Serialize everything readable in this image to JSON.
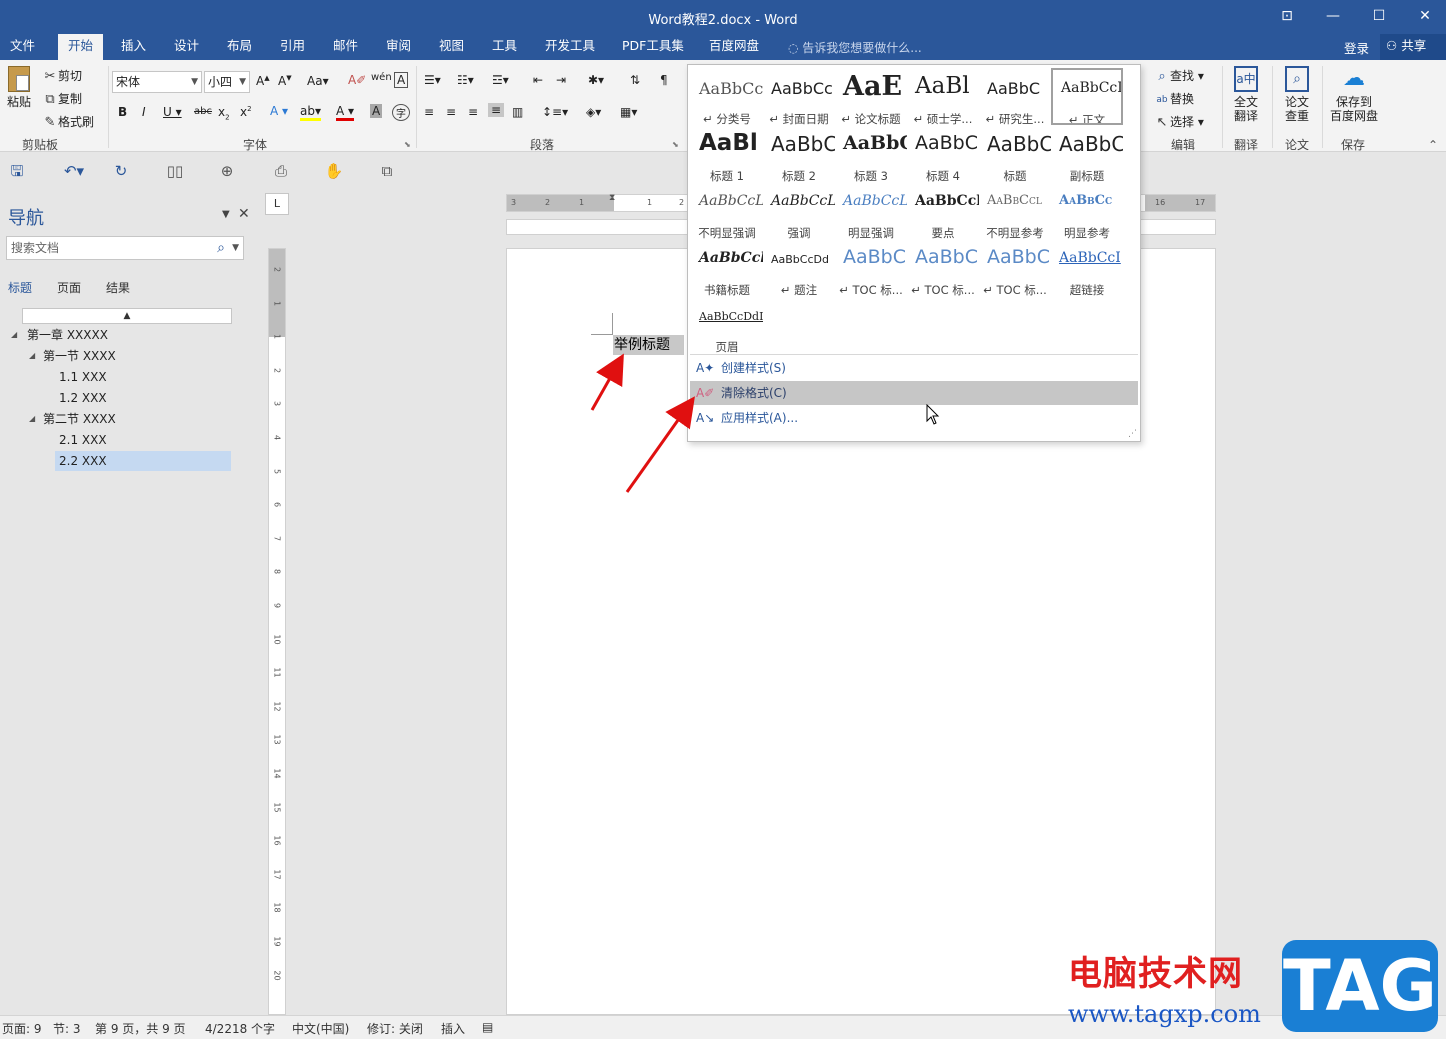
{
  "window": {
    "title": "Word教程2.docx - Word",
    "controls": {
      "ribbon_display": "⊡",
      "minimize": "—",
      "maximize": "☐",
      "close": "✕"
    }
  },
  "menu": {
    "tabs": [
      "文件",
      "开始",
      "插入",
      "设计",
      "布局",
      "引用",
      "邮件",
      "审阅",
      "视图",
      "工具",
      "开发工具",
      "PDF工具集",
      "百度网盘"
    ],
    "active_tab": "开始",
    "tell_me": "告诉我您想要做什么...",
    "login": "登录",
    "share": "共享"
  },
  "ribbon": {
    "clipboard": {
      "paste": "粘贴",
      "cut": "剪切",
      "copy": "复制",
      "format_painter": "格式刷",
      "label": "剪贴板"
    },
    "font": {
      "font_name": "宋体",
      "font_size": "小四",
      "label": "字体"
    },
    "paragraph": {
      "label": "段落"
    },
    "editing": {
      "find": "查找",
      "replace": "替换",
      "select": "选择",
      "label": "编辑"
    },
    "translate": {
      "button": "全文\n翻译",
      "line1": "全文",
      "line2": "翻译",
      "label": "翻译"
    },
    "paper": {
      "line1": "论文",
      "line2": "查重",
      "label": "论文"
    },
    "save": {
      "line1": "保存到",
      "line2": "百度网盘",
      "label": "保存"
    }
  },
  "navigation": {
    "title": "导航",
    "search_placeholder": "搜索文档",
    "tabs": [
      "标题",
      "页面",
      "结果"
    ],
    "active_tab": "标题",
    "tree": [
      {
        "label": "第一章 XXXXX",
        "level": 0
      },
      {
        "label": "第一节 XXXX",
        "level": 1
      },
      {
        "label": "1.1 XXX",
        "level": 2
      },
      {
        "label": "1.2 XXX",
        "level": 2
      },
      {
        "label": "第二节 XXXX",
        "level": 1
      },
      {
        "label": "2.1 XXX",
        "level": 2
      },
      {
        "label": "2.2 XXX",
        "level": 2,
        "selected": true
      }
    ]
  },
  "document": {
    "selected_text": "举例标题"
  },
  "styles_gallery": {
    "styles": [
      {
        "preview": "AaBbCc",
        "name": "↵ 分类号"
      },
      {
        "preview": "AaBbCc",
        "name": "↵ 封面日期"
      },
      {
        "preview": "AaE",
        "name": "↵ 论文标题"
      },
      {
        "preview": "AaBl",
        "name": "↵ 硕士学..."
      },
      {
        "preview": "AaBbC",
        "name": "↵ 研究生..."
      },
      {
        "preview": "AaBbCcI",
        "name": "↵ 正文",
        "selected": true
      },
      {
        "preview": "AaBl",
        "name": "标题 1"
      },
      {
        "preview": "AaBbC",
        "name": "标题 2"
      },
      {
        "preview": "AaBbC",
        "name": "标题 3"
      },
      {
        "preview": "AaBbC",
        "name": "标题 4"
      },
      {
        "preview": "AaBbC",
        "name": "标题"
      },
      {
        "preview": "AaBbC",
        "name": "副标题"
      },
      {
        "preview": "AaBbCcL",
        "name": "不明显强调"
      },
      {
        "preview": "AaBbCcL",
        "name": "强调"
      },
      {
        "preview": "AaBbCcL",
        "name": "明显强调"
      },
      {
        "preview": "AaBbCcl",
        "name": "要点"
      },
      {
        "preview": "AaBbCcl",
        "name": "不明显参考"
      },
      {
        "preview": "AaBbCc",
        "name": "明显参考"
      },
      {
        "preview": "AaBbCcl",
        "name": "书籍标题"
      },
      {
        "preview": "AaBbCcDd",
        "name": "↵ 题注"
      },
      {
        "preview": "AaBbC",
        "name": "↵ TOC 标..."
      },
      {
        "preview": "AaBbC",
        "name": "↵ TOC 标..."
      },
      {
        "preview": "AaBbC",
        "name": "↵ TOC 标..."
      },
      {
        "preview": "AaBbCcI",
        "name": "超链接"
      },
      {
        "preview": "AaBbCcDdI",
        "name": "页眉"
      }
    ],
    "menu": [
      {
        "label": "创建样式(S)"
      },
      {
        "label": "清除格式(C)",
        "highlighted": true
      },
      {
        "label": "应用样式(A)..."
      }
    ]
  },
  "ruler": {
    "h_ticks": [
      "3",
      "2",
      "1",
      "1",
      "2",
      "16",
      "17"
    ],
    "v_ticks": [
      "2",
      "1",
      "1",
      "2",
      "3",
      "4",
      "5",
      "6",
      "7",
      "8",
      "9",
      "10",
      "11",
      "12",
      "13",
      "14",
      "15",
      "16",
      "17",
      "18",
      "19",
      "20"
    ],
    "tab_selector": "L"
  },
  "status_bar": {
    "page": "页面: 9",
    "section": "节: 3",
    "page_of": "第 9 页，共 9 页",
    "words": "4/2218 个字",
    "language": "中文(中国)",
    "track_changes": "修订: 关闭",
    "mode": "插入"
  },
  "watermark": {
    "text": "电脑技术网",
    "url": "www.tagxp.com",
    "logo": "TAG"
  },
  "colors": {
    "brand": "#2b579a",
    "arrow": "#e01010",
    "selection": "#c5d9f1"
  }
}
